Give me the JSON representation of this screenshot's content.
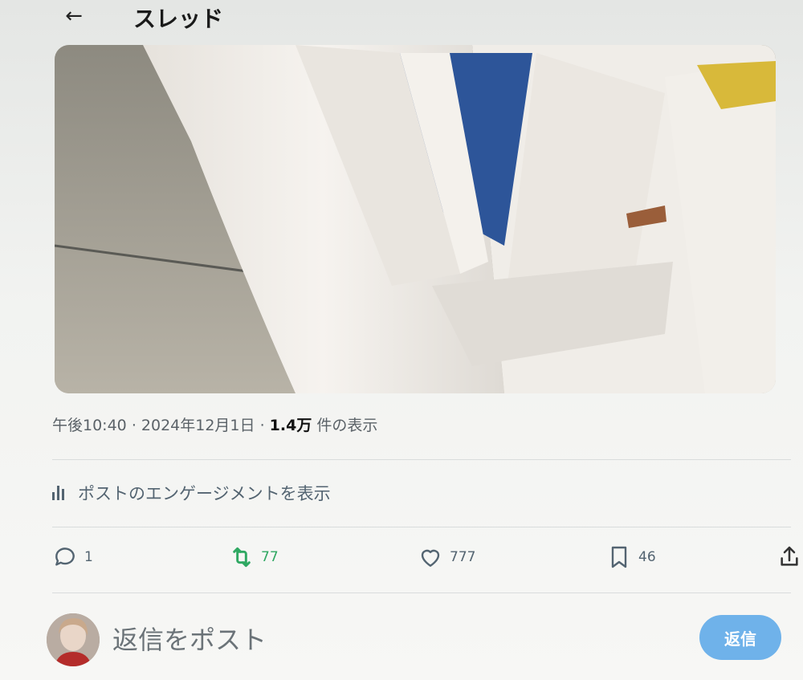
{
  "header": {
    "back_icon": "arrow-left-icon",
    "title": "スレッド"
  },
  "post": {
    "time": "午後10:40",
    "separator": "·",
    "date": "2024年12月1日",
    "views_count": "1.4万",
    "views_label": "件の表示",
    "engagement_link": "ポストのエンゲージメントを表示"
  },
  "actions": {
    "replies": "1",
    "retweets": "77",
    "likes": "777",
    "bookmarks": "46"
  },
  "reply": {
    "placeholder": "返信をポスト",
    "button_label": "返信"
  },
  "colors": {
    "retweet_green": "#2fa862",
    "reply_button": "#6fb2ea",
    "secondary_text": "#536471"
  }
}
